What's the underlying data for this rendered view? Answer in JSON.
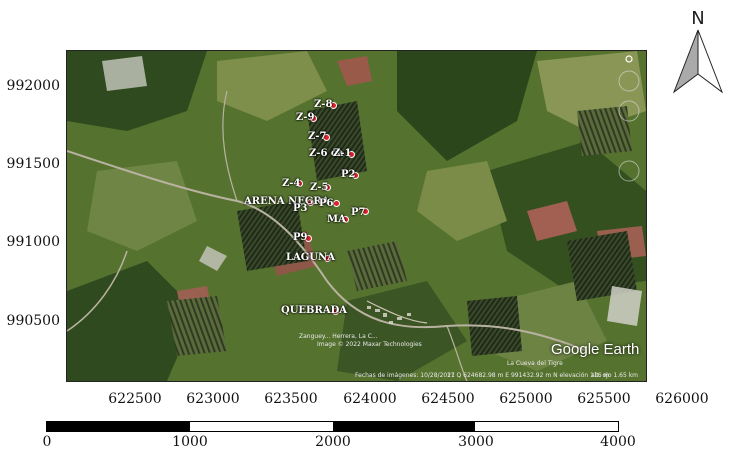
{
  "map": {
    "y_ticks": [
      "992000",
      "991500",
      "991000",
      "990500"
    ],
    "x_ticks": [
      "622500",
      "623000",
      "623500",
      "624000",
      "624500",
      "625000",
      "625500",
      "626000"
    ],
    "points": [
      {
        "label": "Z-8"
      },
      {
        "label": "Z-9"
      },
      {
        "label": "Z-7"
      },
      {
        "label": "Z-6 ca"
      },
      {
        "label": "Z-1"
      },
      {
        "label": "P2"
      },
      {
        "label": "Z-4"
      },
      {
        "label": "Z-5"
      },
      {
        "label": "ARENA NEGRA"
      },
      {
        "label": "P3"
      },
      {
        "label": "P6"
      },
      {
        "label": "P7"
      },
      {
        "label": "MA"
      },
      {
        "label": "P9"
      },
      {
        "label": "LAGUNA"
      },
      {
        "label": "QUEBRADA"
      }
    ],
    "attribution": {
      "line1": "Zanguey... Herrera, La C...",
      "line2": "Image © 2022 Maxar Technologies",
      "imagery_date": "Fechas de imágenes: 10/28/2021",
      "coords": "17 Q 624682.98 m E 991432.92 m N   elevación   116 m",
      "alt": "alt. ojo   1.65 km",
      "place": "La Cueva del Tigre"
    },
    "logo": "Google Earth",
    "colors": {
      "point": "#e3202a",
      "label": "#ffffff"
    }
  },
  "scale": {
    "labels": [
      "0",
      "1000",
      "2000",
      "3000",
      "4000"
    ]
  },
  "north": {
    "letter": "N"
  }
}
